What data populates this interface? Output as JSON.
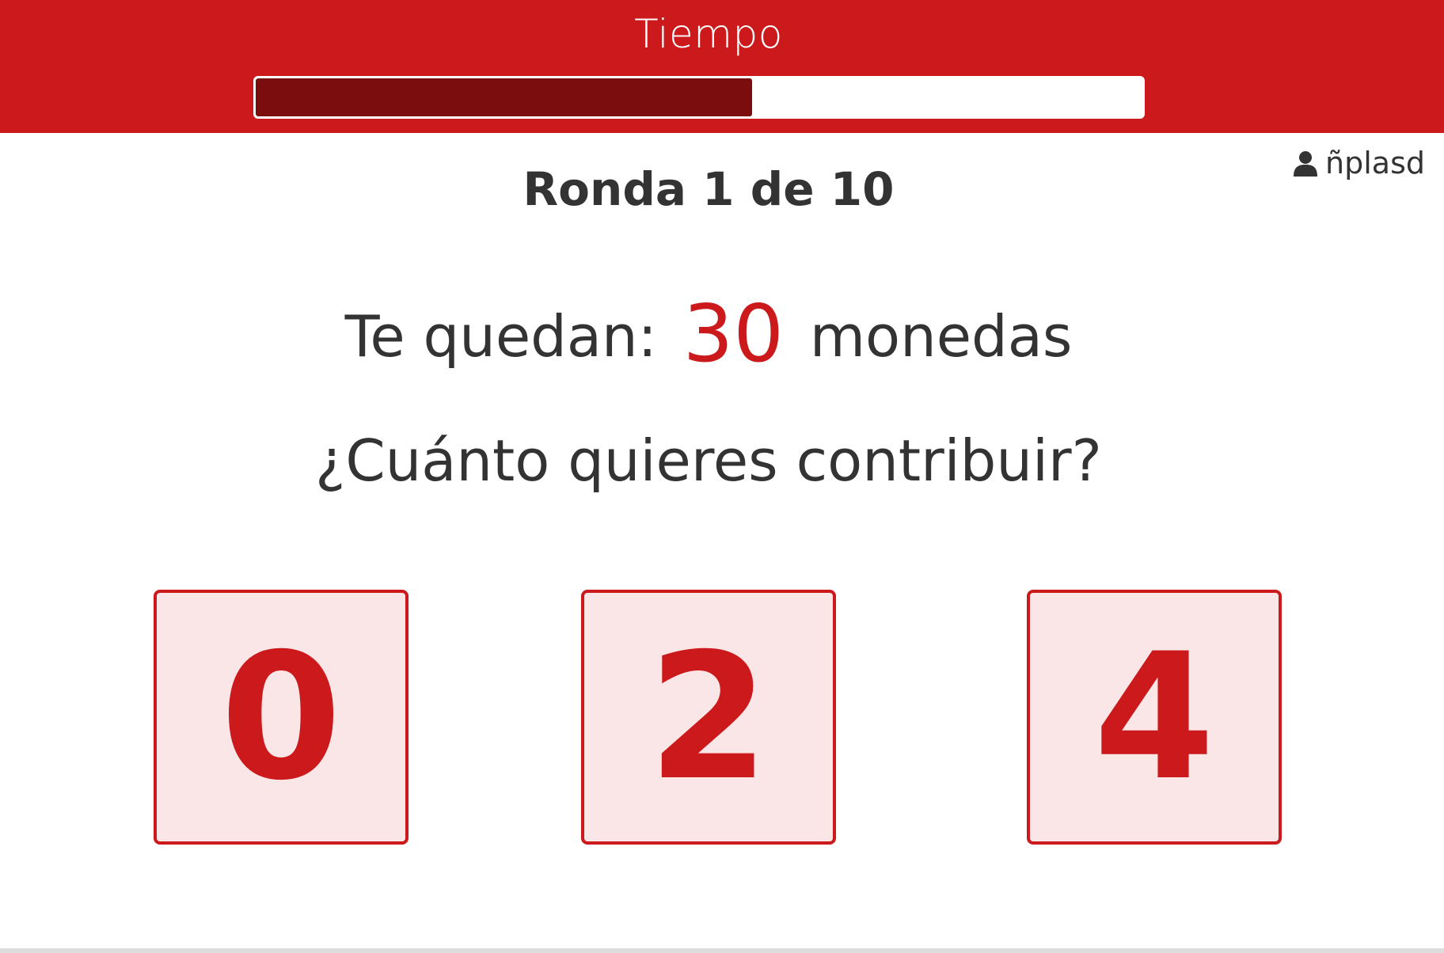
{
  "header": {
    "title": "Tiempo",
    "timer_progress": 0.56
  },
  "user": {
    "icon": "user-icon",
    "name": "ñplasd"
  },
  "round": {
    "label": "Ronda 1 de 10"
  },
  "coins": {
    "prefix": "Te quedan:",
    "amount": "30",
    "suffix": "monedas"
  },
  "question": "¿Cuánto quieres contribuir?",
  "choices": [
    "0",
    "2",
    "4"
  ],
  "colors": {
    "brand": "#cc1a1c",
    "timer_fill": "#7b0d0f",
    "choice_bg": "#fae6e7",
    "text": "#333333"
  }
}
